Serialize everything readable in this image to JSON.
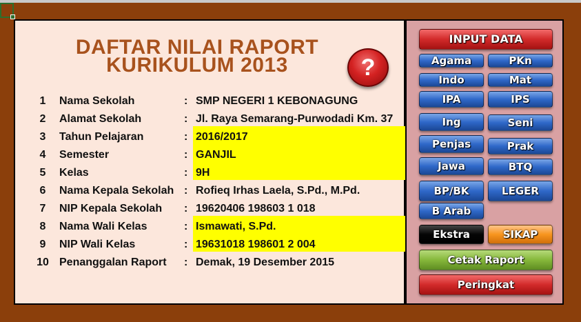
{
  "title_line1": "DAFTAR NILAI RAPORT",
  "title_line2": "KURIKULUM 2013",
  "help_button": "?",
  "fields": [
    {
      "no": "1",
      "label": "Nama Sekolah",
      "colon": ":",
      "value": "SMP NEGERI 1 KEBONAGUNG"
    },
    {
      "no": "2",
      "label": "Alamat Sekolah",
      "colon": ":",
      "value": "Jl. Raya Semarang-Purwodadi Km. 37"
    },
    {
      "no": "3",
      "label": "Tahun Pelajaran",
      "colon": ":",
      "value": "2016/2017"
    },
    {
      "no": "4",
      "label": "Semester",
      "colon": ":",
      "value": "GANJIL"
    },
    {
      "no": "5",
      "label": "Kelas",
      "colon": ":",
      "value": "9H"
    },
    {
      "no": "6",
      "label": "Nama Kepala Sekolah",
      "colon": ":",
      "value": "Rofieq Irhas Laela, S.Pd., M.Pd."
    },
    {
      "no": "7",
      "label": "NIP Kepala Sekolah",
      "colon": ":",
      "value": "19620406 198603 1 018"
    },
    {
      "no": "8",
      "label": "Nama Wali Kelas",
      "colon": ":",
      "value": "Ismawati, S.Pd."
    },
    {
      "no": "9",
      "label": "NIP Wali Kelas",
      "colon": ":",
      "value": "19631018 198601 2 004"
    },
    {
      "no": "10",
      "label": "Penanggalan Raport",
      "colon": ":",
      "value": "Demak, 19 Desember 2015"
    }
  ],
  "buttons": {
    "input_data": "INPUT DATA",
    "agama": "Agama",
    "pkn": "PKn",
    "indo": "Indo",
    "mat": "Mat",
    "ipa": "IPA",
    "ips": "IPS",
    "ing": "Ing",
    "seni": "Seni",
    "penjas": "Penjas",
    "prak": "Prak",
    "jawa": "Jawa",
    "btq": "BTQ",
    "bpbk": "BP/BK",
    "leger": "LEGER",
    "barab": "B Arab",
    "ekstra": "Ekstra",
    "sikap": "SIKAP",
    "cetak": "Cetak Raport",
    "peringkat": "Peringkat"
  },
  "colors": {
    "background": "#8b3f0b",
    "panel": "#fce7dc",
    "side_panel": "#d9a1a3",
    "title": "#a8521d",
    "highlight": "#ffff00"
  }
}
